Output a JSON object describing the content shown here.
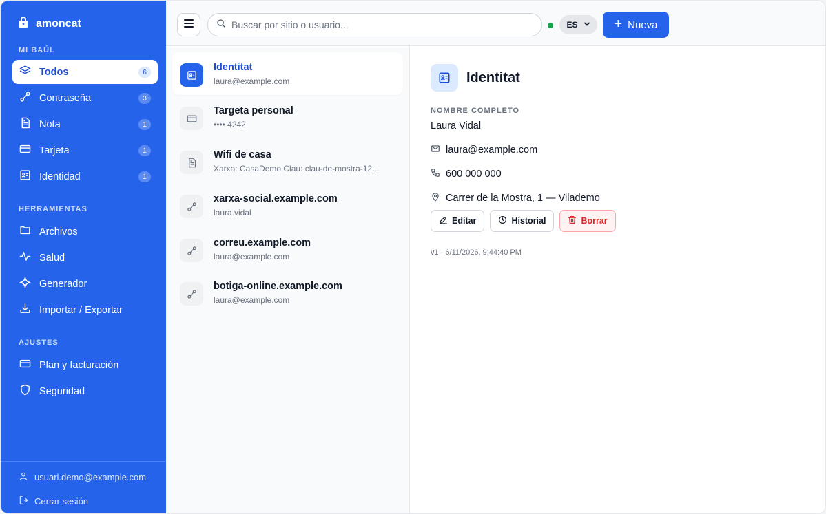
{
  "app": {
    "name": "amoncat"
  },
  "sidebar": {
    "sections": {
      "vault": "MI BAÚL",
      "tools": "HERRAMIENTAS",
      "settings": "AJUSTES"
    },
    "vault_items": [
      {
        "label": "Todos",
        "count": "6",
        "icon": "layers-icon",
        "active": true
      },
      {
        "label": "Contraseña",
        "count": "3",
        "icon": "link-icon"
      },
      {
        "label": "Nota",
        "count": "1",
        "icon": "note-icon"
      },
      {
        "label": "Tarjeta",
        "count": "1",
        "icon": "card-icon"
      },
      {
        "label": "Identidad",
        "count": "1",
        "icon": "id-card-icon"
      }
    ],
    "tool_items": [
      {
        "label": "Archivos",
        "icon": "folder-icon"
      },
      {
        "label": "Salud",
        "icon": "pulse-icon"
      },
      {
        "label": "Generador",
        "icon": "sparkle-icon"
      },
      {
        "label": "Importar / Exportar",
        "icon": "download-icon"
      }
    ],
    "settings_items": [
      {
        "label": "Plan y facturación",
        "icon": "card-icon"
      },
      {
        "label": "Seguridad",
        "icon": "shield-icon"
      }
    ],
    "footer": {
      "user_email": "usuari.demo@example.com",
      "logout_label": "Cerrar sesión"
    }
  },
  "topbar": {
    "search_placeholder": "Buscar por sitio o usuario...",
    "language": "ES",
    "new_label": "Nueva",
    "status_color": "#16a34a"
  },
  "list": [
    {
      "title": "Identitat",
      "subtitle": "laura@example.com",
      "icon": "id-card-icon",
      "selected": true
    },
    {
      "title": "Targeta personal",
      "subtitle": "•••• 4242",
      "icon": "card-icon"
    },
    {
      "title": "Wifi de casa",
      "subtitle": "Xarxa: CasaDemo Clau: clau-de-mostra-12...",
      "icon": "note-icon"
    },
    {
      "title": "xarxa-social.example.com",
      "subtitle": "laura.vidal",
      "icon": "link-icon"
    },
    {
      "title": "correu.example.com",
      "subtitle": "laura@example.com",
      "icon": "link-icon"
    },
    {
      "title": "botiga-online.example.com",
      "subtitle": "laura@example.com",
      "icon": "link-icon"
    }
  ],
  "detail": {
    "title": "Identitat",
    "full_name_label": "NOMBRE COMPLETO",
    "full_name": "Laura Vidal",
    "email": "laura@example.com",
    "phone": "600 000 000",
    "address": "Carrer de la Mostra, 1 — Vilademo",
    "actions": {
      "edit": "Editar",
      "history": "Historial",
      "delete": "Borrar"
    },
    "meta": "v1 · 6/11/2026, 9:44:40 PM"
  },
  "colors": {
    "accent": "#2563eb",
    "danger": "#dc2626",
    "online": "#16a34a"
  }
}
